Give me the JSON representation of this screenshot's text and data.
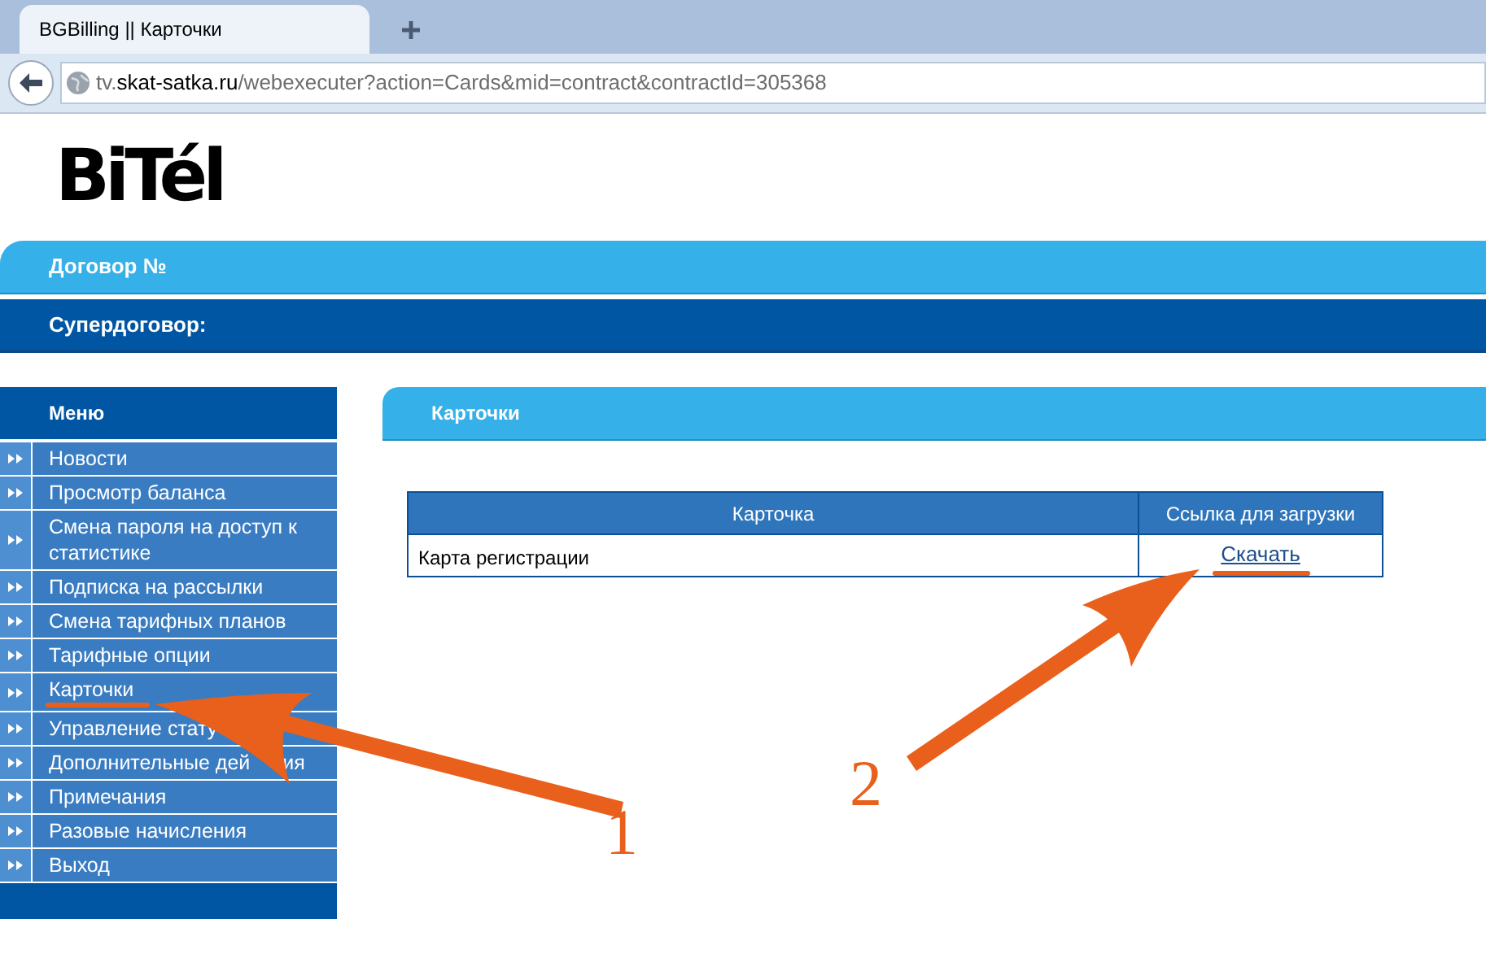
{
  "browser": {
    "tab_title": "BGBilling || Карточки",
    "url": {
      "host_prefix": "tv.",
      "domain": "skat-satka.ru",
      "path": "/webexecuter?action=Cards&mid=contract&contractId=305368"
    }
  },
  "logo": "BiTél",
  "contract_bar": {
    "label": "Договор №"
  },
  "supercontract_bar": {
    "label": "Супердоговор:"
  },
  "menu": {
    "title": "Меню",
    "items": [
      {
        "label": "Новости",
        "highlighted": false
      },
      {
        "label": "Просмотр баланса",
        "highlighted": false
      },
      {
        "label": "Смена пароля на доступ к статистике",
        "highlighted": false
      },
      {
        "label": "Подписка на рассылки",
        "highlighted": false
      },
      {
        "label": "Смена тарифных планов",
        "highlighted": false
      },
      {
        "label": "Тарифные опции",
        "highlighted": false
      },
      {
        "label": "Карточки",
        "highlighted": true
      },
      {
        "label": "Управление стату",
        "highlighted": false
      },
      {
        "label": "Дополнительные дей",
        "tail": "ия",
        "highlighted": false
      },
      {
        "label": "Примечания",
        "highlighted": false
      },
      {
        "label": "Разовые начисления",
        "highlighted": false
      },
      {
        "label": "Выход",
        "highlighted": false
      }
    ]
  },
  "content": {
    "title": "Карточки",
    "table": {
      "columns": [
        "Карточка",
        "Ссылка для загрузки"
      ],
      "rows": [
        {
          "card": "Карта регистрации",
          "link": "Скачать",
          "highlighted": true
        }
      ]
    }
  },
  "annotations": [
    {
      "label": "1"
    },
    {
      "label": "2"
    }
  ]
}
